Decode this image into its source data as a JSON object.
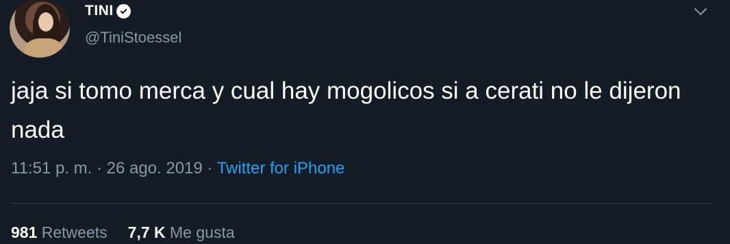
{
  "tweet": {
    "author": {
      "display_name": "TINI",
      "handle": "@TiniStoessel",
      "verified_icon": "verified-badge-icon",
      "avatar": "profile-photo"
    },
    "text": "jaja si tomo merca y cual hay mogolicos si a cerati no le dijeron nada",
    "timestamp": "11:51 p. m. · 26 ago. 2019",
    "separator": " · ",
    "source": "Twitter for iPhone",
    "menu_icon": "chevron-down-icon"
  },
  "stats": {
    "retweets_count": "981",
    "retweets_label": "Retweets",
    "likes_count": "7,7 K",
    "likes_label": "Me gusta"
  },
  "colors": {
    "background": "#141d26",
    "secondary_text": "#8899a6",
    "link": "#1da1f2",
    "divider": "#38444d"
  }
}
